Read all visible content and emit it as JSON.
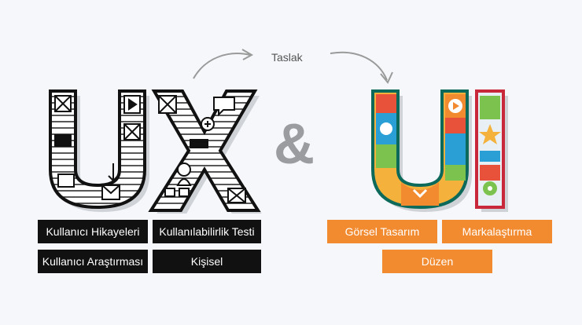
{
  "flow": {
    "arrow_label": "Taslak"
  },
  "ux": {
    "tags": [
      "Kullanıcı Hikayeleri",
      "Kullanılabilirlik Testi",
      "Kullanıcı Araştırması",
      "Kişisel"
    ]
  },
  "ui": {
    "tags": [
      "Görsel Tasarım",
      "Markalaştırma",
      "Düzen"
    ]
  },
  "colors": {
    "background": "#f5f7fa",
    "ux_ink": "#111111",
    "ux_tag": "#111111",
    "ui_tag": "#f28a30",
    "ui_outline": "#0d6a5a",
    "ui_outline_red": "#c8283a",
    "ampersand": "#9a9ca0"
  }
}
